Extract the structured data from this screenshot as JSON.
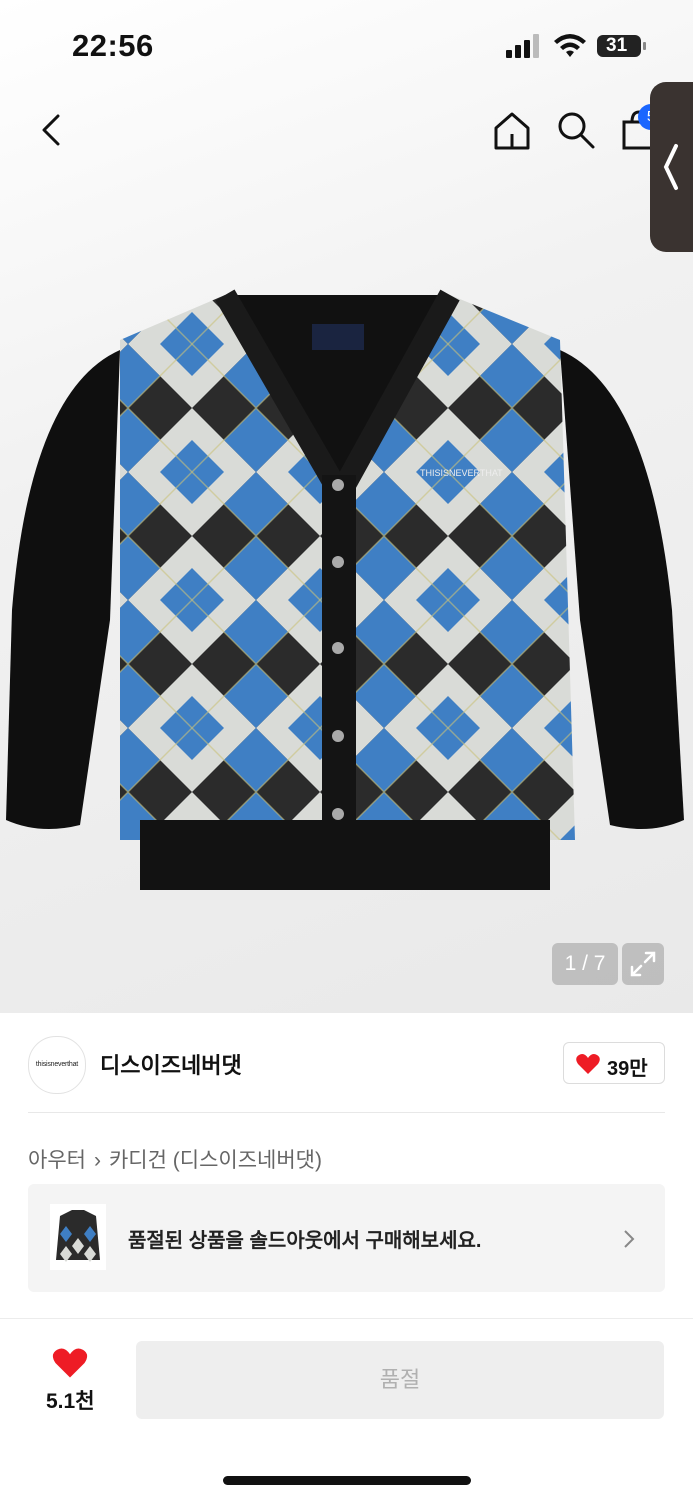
{
  "status_bar": {
    "time": "22:56",
    "battery": "31"
  },
  "header": {
    "cart_count": "5"
  },
  "gallery": {
    "current": "1",
    "total": "7",
    "counter": "1 / 7",
    "product_logo_text": "THISISNEVERTHAT"
  },
  "brand": {
    "logo_text": "thisisneverthat",
    "name": "디스이즈네버댓",
    "likes": "39만"
  },
  "breadcrumb": {
    "category": "아우터",
    "subcategory": "카디건 (디스이즈네버댓)"
  },
  "soldout_banner": {
    "text": "품절된 상품을 솔드아웃에서 구매해보세요."
  },
  "bottom_bar": {
    "favorite_count": "5.1천",
    "buy_label": "품절"
  },
  "colors": {
    "accent_red": "#ee1c25",
    "badge_blue": "#1a66ff",
    "cardigan_blue": "#3f7fc4"
  }
}
